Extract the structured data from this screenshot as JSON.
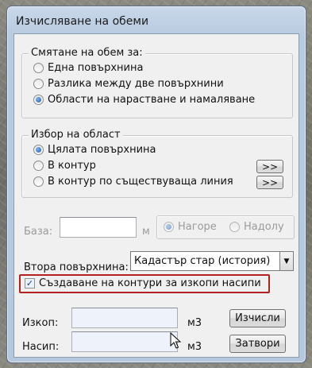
{
  "window": {
    "title": "Изчисляване на обеми"
  },
  "volume_group": {
    "legend": "Смятане на обем за:",
    "options": [
      {
        "label": "Една повърхнина",
        "selected": false
      },
      {
        "label": "Разлика между две повърхнини",
        "selected": false
      },
      {
        "label": "Области на нарастване и намаляване",
        "selected": true
      }
    ]
  },
  "area_group": {
    "legend": "Избор на област",
    "options": [
      {
        "label": "Цялата повърхнина",
        "selected": true
      },
      {
        "label": "В контур",
        "selected": false
      },
      {
        "label": "В контур по съществуваща линия",
        "selected": false
      }
    ],
    "pick_button_label": ">>"
  },
  "base": {
    "label": "База:",
    "value": "",
    "unit": "м",
    "direction": [
      {
        "label": "Нагоре",
        "selected": true
      },
      {
        "label": "Надолу",
        "selected": false
      }
    ]
  },
  "second_surface": {
    "label": "Втора повърхнина:",
    "selected": "Кадастър стар (история)",
    "arrow": "▼"
  },
  "create_contours": {
    "label": "Създаване на контури за изкопи насипи",
    "checked": true,
    "check_mark": "✓"
  },
  "excavation": {
    "label": "Изкоп:",
    "value": "",
    "unit": "м3"
  },
  "fill": {
    "label": "Насип:",
    "value": "",
    "unit": "м3"
  },
  "buttons": {
    "calculate": "Изчисли",
    "close": "Затвори"
  }
}
